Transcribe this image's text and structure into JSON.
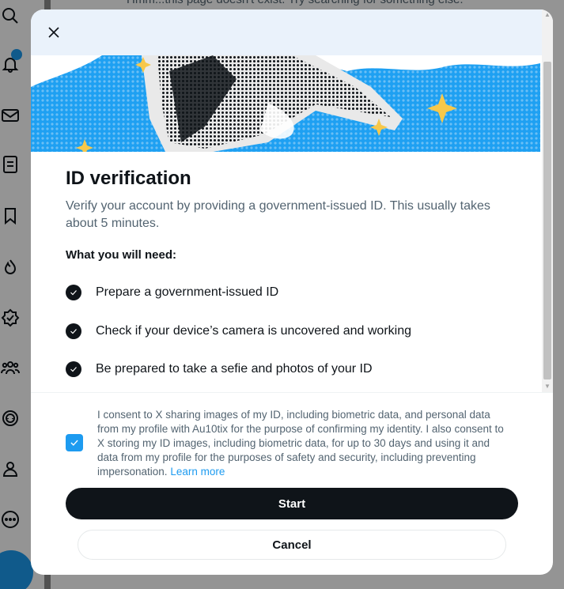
{
  "background": {
    "message": "Hmm...this page doesn't exist. Try searching for something else.",
    "nav_icons": [
      "search-icon",
      "notifications-icon",
      "messages-icon",
      "lists-icon",
      "bookmarks-icon",
      "communities-icon",
      "verified-icon",
      "people-icon",
      "grok-icon",
      "profile-icon",
      "more-icon"
    ],
    "notification_badge_color": "#1d9bf0"
  },
  "modal": {
    "close_label": "Close",
    "title": "ID verification",
    "description": "Verify your account by providing a government-issued ID. This usually takes about 5 minutes.",
    "requirements_heading": "What you will need:",
    "requirements": [
      "Prepare a government-issued ID",
      "Check if your device’s camera is uncovered and working",
      "Be prepared to take a sefie and photos of your ID"
    ],
    "consent": {
      "checked": true,
      "text": "I consent to X sharing images of my ID, including biometric data, and personal data from my profile with Au10tix for the purpose of confirming my identity. I also consent to X storing my ID images, including biometric data, for up to 30 days and using it and data from my profile for the purposes of safety and security, including preventing impersonation. ",
      "link_text": "Learn more"
    },
    "start_label": "Start",
    "cancel_label": "Cancel"
  },
  "colors": {
    "accent": "#1d9bf0",
    "primary_text": "#0f1419",
    "secondary_text": "#536471"
  }
}
